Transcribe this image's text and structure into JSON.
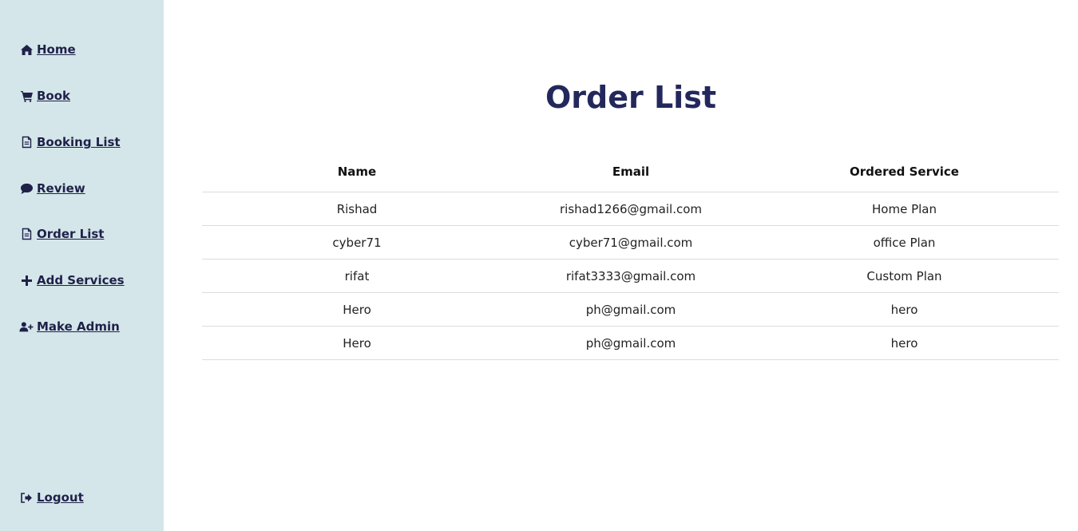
{
  "sidebar": {
    "items": [
      {
        "label": " Home",
        "icon": "home-icon"
      },
      {
        "label": " Book",
        "icon": "cart-icon"
      },
      {
        "label": " Booking List",
        "icon": "file-icon"
      },
      {
        "label": " Review",
        "icon": "comment-icon"
      },
      {
        "label": " Order List",
        "icon": "file-icon"
      },
      {
        "label": " Add Services",
        "icon": "plus-icon"
      },
      {
        "label": " Make Admin",
        "icon": "user-plus-icon"
      }
    ],
    "logout": {
      "label": " Logout",
      "icon": "sign-out-icon"
    }
  },
  "main": {
    "title": "Order List",
    "table": {
      "headers": [
        "Name",
        "Email",
        "Ordered Service"
      ],
      "rows": [
        [
          "Rishad",
          "rishad1266@gmail.com",
          "Home Plan"
        ],
        [
          "cyber71",
          "cyber71@gmail.com",
          "office Plan"
        ],
        [
          "rifat",
          "rifat3333@gmail.com",
          "Custom Plan"
        ],
        [
          "Hero",
          "ph@gmail.com",
          "hero"
        ],
        [
          "Hero",
          "ph@gmail.com",
          "hero"
        ]
      ]
    }
  },
  "colors": {
    "sidebar_bg": "#d5e6ea",
    "nav_text": "#1f2149",
    "title": "#23285c"
  }
}
